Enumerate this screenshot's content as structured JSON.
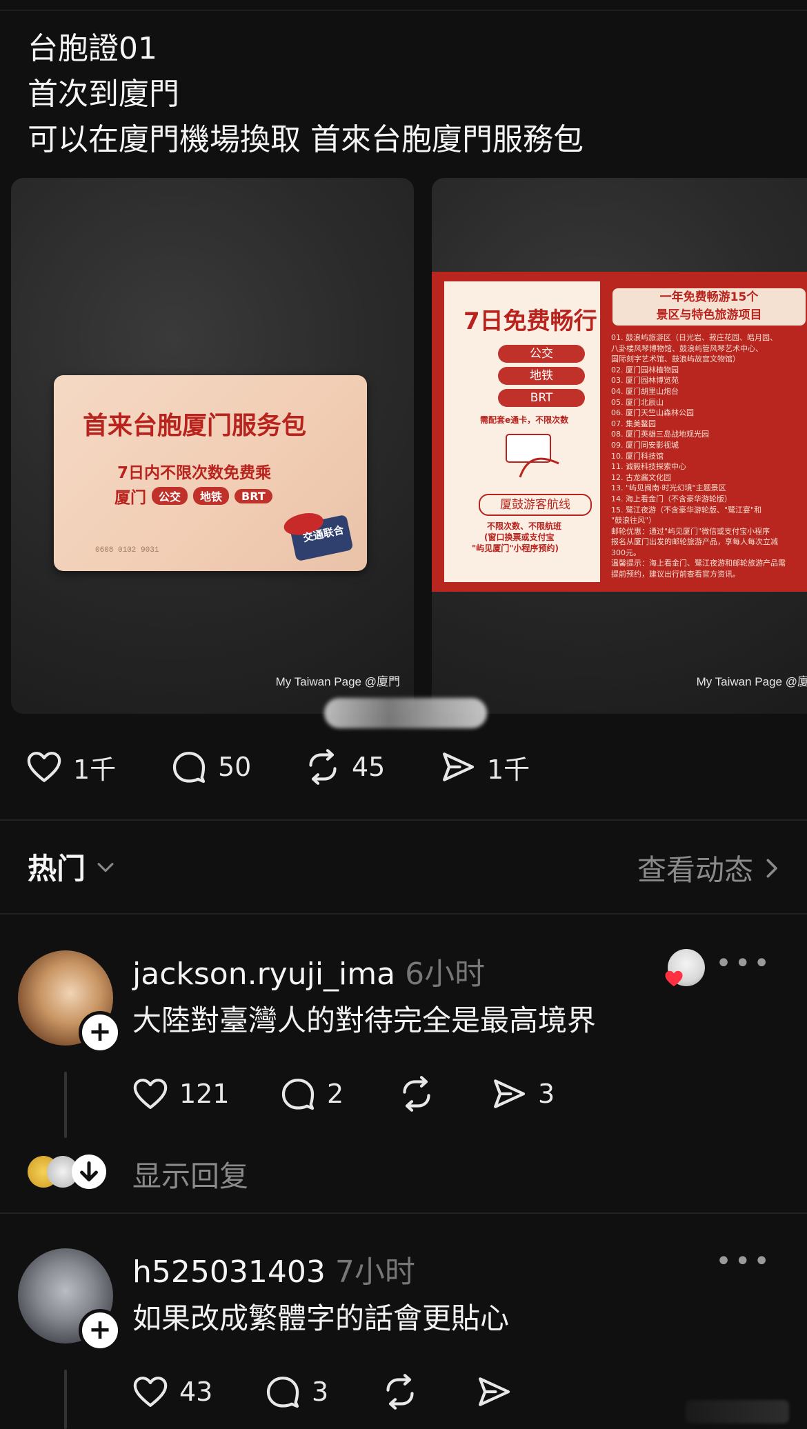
{
  "post": {
    "lines": [
      "台胞證01",
      "首次到廈門",
      "可以在廈門機場換取 首來台胞廈門服務包"
    ]
  },
  "photos": {
    "watermark": "My Taiwan Page @廈門",
    "card": {
      "title": "首来台胞厦门服务包",
      "subtitle": "7日内不限次数免费乘",
      "city": "厦门",
      "modes": [
        "公交",
        "地铁",
        "BRT"
      ],
      "number": "0608 0102 9031",
      "logo": "交通联合"
    },
    "flyer": {
      "heading": "7日免费畅行",
      "modes": [
        "公交",
        "地铁",
        "BRT"
      ],
      "note": "需配套e通卡，不限次数",
      "ferry": "厦鼓游客航线",
      "ferry_note1": "不限次数、不限航班",
      "ferry_note2": "(窗口换票或支付宝",
      "ferry_note3": "\"屿见厦门\"小程序预约)",
      "right_heading_1": "一年免费畅游15个",
      "right_heading_2": "景区与特色旅游项目",
      "list": [
        "01. 鼓浪屿旅游区（日光岩、菽庄花园、皓月园、",
        "    八卦楼风琴博物馆、鼓浪屿管风琴艺术中心、",
        "    国际刻字艺术馆、鼓浪屿故宫文物馆）",
        "02. 厦门园林植物园",
        "03. 厦门园林博览苑",
        "04. 厦门胡里山炮台",
        "05. 厦门北辰山",
        "06. 厦门天竺山森林公园",
        "07. 集美鳌园",
        "08. 厦门英雄三岛战地观光园",
        "09. 厦门同安影视城",
        "10. 厦门科技馆",
        "11. 诚毅科技探索中心",
        "12. 古龙酱文化园",
        "13. \"屿见闽南·时光幻境\"主题景区",
        "14. 海上看金门（不含豪华游轮版）",
        "15. 鹭江夜游（不含豪华游轮版、\"鹭江宴\"和",
        "    \"鼓浪往风\"）",
        "邮轮优惠：通过\"屿见厦门\"微信或支付宝小程序",
        "报名从厦门出发的邮轮旅游产品，享每人每次立减",
        "300元。",
        "温馨提示：海上看金门、鹭江夜游和邮轮旅游产品需",
        "    提前预约，建议出行前查看官方资讯。"
      ]
    }
  },
  "actions": {
    "likes": "1千",
    "comments": "50",
    "reposts": "45",
    "shares": "1千"
  },
  "sort": {
    "label": "热门",
    "activity": "查看动态"
  },
  "comments": [
    {
      "username": "jackson.ryuji_ima",
      "time": "6小时",
      "text": "大陸對臺灣人的對待完全是最高境界",
      "likes": "121",
      "replies": "2",
      "shares": "3"
    },
    {
      "username": "h525031403",
      "time": "7小时",
      "text": "如果改成繁體字的話會更貼心",
      "likes": "43",
      "replies": "3"
    }
  ],
  "show_replies": "显示回复",
  "colors": {
    "background": "#101010",
    "text": "#f3f3f3",
    "muted": "#8a8a8a",
    "brand_red": "#b8231e"
  },
  "icons": [
    "heart-icon",
    "comment-icon",
    "repost-icon",
    "share-icon",
    "chevron-down-icon",
    "chevron-right-icon",
    "plus-icon",
    "more-icon"
  ]
}
